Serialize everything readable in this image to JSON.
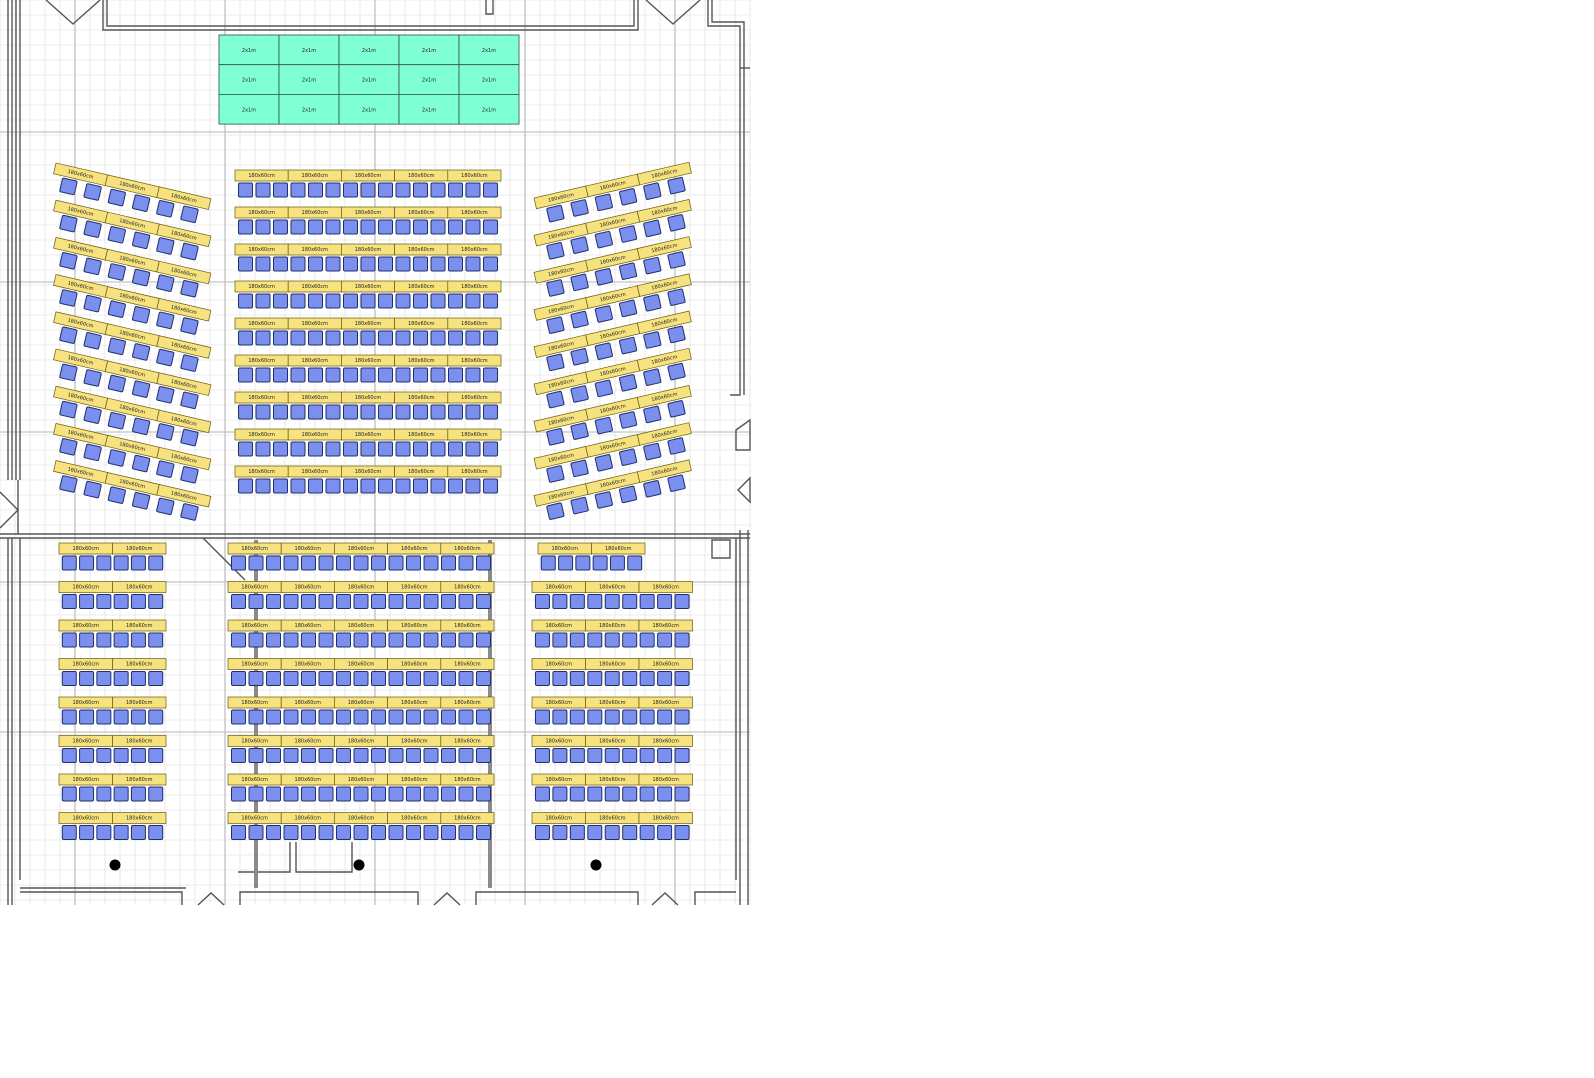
{
  "plan": {
    "stage_panel_label": "2x1m",
    "table_label": "180x60cm"
  },
  "colors": {
    "background": "#ffffff",
    "grid_line": "#dcdcdc",
    "grid_major": "#c4c4c4",
    "wall": "#555555",
    "stage_fill": "#7fffd4",
    "stage_stroke": "#2f4f4f",
    "table_fill": "#f6e27f",
    "table_stroke": "#6b5a10",
    "chair_fill": "#7b8fef",
    "chair_stroke": "#20306a",
    "column_fill": "#000000"
  },
  "stage": {
    "rows": 3,
    "cols": 5
  },
  "seating": {
    "front_left": {
      "rows": 9,
      "tables_per_row": 3,
      "chairs_per_row": 6,
      "rotation_deg": 13
    },
    "front_center": {
      "rows": 9,
      "tables_per_row": 5,
      "chairs_per_row": 15,
      "rotation_deg": 0
    },
    "front_right": {
      "rows": 9,
      "tables_per_row": 3,
      "chairs_per_row": 6,
      "rotation_deg": -13
    },
    "rear_left": {
      "rows": 8,
      "tables_per_row": 2,
      "chairs_per_row": 6
    },
    "rear_center": {
      "rows": 8,
      "tables_per_row": 5,
      "chairs_per_row": 15
    },
    "rear_right": {
      "rows": 8,
      "tables_per_row": 3,
      "chairs_per_row": 9,
      "first_row_tables": 2,
      "first_row_chairs": 6
    }
  },
  "columns_count": 3
}
